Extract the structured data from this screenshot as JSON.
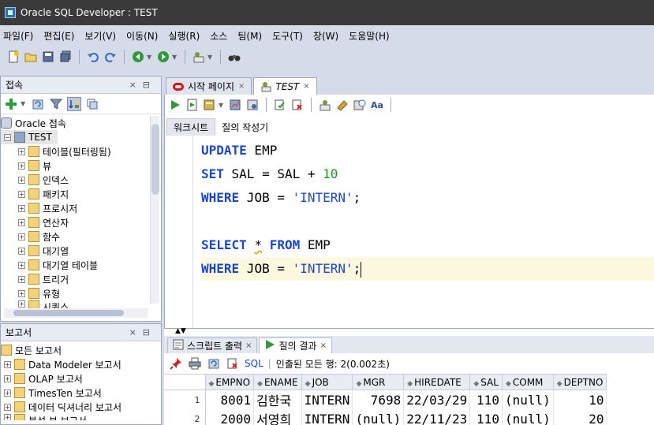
{
  "window": {
    "title": "Oracle SQL Developer : TEST"
  },
  "menu": [
    "파일(F)",
    "편집(E)",
    "보기(V)",
    "이동(N)",
    "실행(R)",
    "소스",
    "팀(M)",
    "도구(T)",
    "창(W)",
    "도움말(H)"
  ],
  "connections_panel": {
    "title": "접속",
    "tree": [
      {
        "label": "Oracle 접속",
        "level": 0,
        "icon": "database-icon",
        "expand": ""
      },
      {
        "label": "TEST",
        "level": 1,
        "icon": "connection-icon",
        "expand": "−"
      },
      {
        "label": "테이블(필터링됨)",
        "level": 2,
        "icon": "table-icon",
        "expand": "+"
      },
      {
        "label": "뷰",
        "level": 2,
        "icon": "view-icon",
        "expand": "+"
      },
      {
        "label": "인덱스",
        "level": 2,
        "icon": "index-icon",
        "expand": "+"
      },
      {
        "label": "패키지",
        "level": 2,
        "icon": "package-icon",
        "expand": "+"
      },
      {
        "label": "프로시저",
        "level": 2,
        "icon": "procedure-icon",
        "expand": "+"
      },
      {
        "label": "연산자",
        "level": 2,
        "icon": "operator-icon",
        "expand": "+"
      },
      {
        "label": "함수",
        "level": 2,
        "icon": "function-icon",
        "expand": "+"
      },
      {
        "label": "대기열",
        "level": 2,
        "icon": "queue-icon",
        "expand": "+"
      },
      {
        "label": "대기열 테이블",
        "level": 2,
        "icon": "queue-table-icon",
        "expand": "+"
      },
      {
        "label": "트리거",
        "level": 2,
        "icon": "trigger-icon",
        "expand": "+"
      },
      {
        "label": "유형",
        "level": 2,
        "icon": "type-icon",
        "expand": "+"
      },
      {
        "label": "시퀀스",
        "level": 2,
        "icon": "sequence-icon",
        "expand": "+"
      }
    ]
  },
  "reports_panel": {
    "title": "보고서",
    "tree": [
      {
        "label": "모든 보고서",
        "level": 0,
        "expand": ""
      },
      {
        "label": "Data Modeler 보고서",
        "level": 1,
        "expand": "+"
      },
      {
        "label": "OLAP 보고서",
        "level": 1,
        "expand": "+"
      },
      {
        "label": "TimesTen 보고서",
        "level": 1,
        "expand": "+"
      },
      {
        "label": "데이터 딕셔너리 보고서",
        "level": 1,
        "expand": "+"
      },
      {
        "label": "분석 뷰 보고서",
        "level": 1,
        "expand": "+"
      }
    ]
  },
  "editor_tabs": [
    {
      "label": "시작 페이지",
      "active": false
    },
    {
      "label": "TEST",
      "active": true
    }
  ],
  "worksheet_tabs": [
    "워크시트",
    "질의 작성기"
  ],
  "code_lines": [
    [
      [
        "kw",
        "UPDATE"
      ],
      [
        "",
        "  EMP"
      ]
    ],
    [
      [
        "kw",
        "SET"
      ],
      [
        "",
        "  SAL = SAL + "
      ],
      [
        "num",
        "10"
      ]
    ],
    [
      [
        "kw",
        "WHERE"
      ],
      [
        "",
        "  JOB = "
      ],
      [
        "str",
        "'INTERN'"
      ],
      [
        "",
        ";"
      ]
    ],
    [],
    [
      [
        "kw",
        "SELECT"
      ],
      [
        "",
        "  "
      ],
      [
        "squig",
        "*"
      ],
      [
        "",
        "  "
      ],
      [
        "kw",
        "FROM"
      ],
      [
        "",
        "  EMP"
      ]
    ],
    [
      [
        "kw",
        "WHERE"
      ],
      [
        "",
        "  JOB = "
      ],
      [
        "str",
        "'INTERN'"
      ],
      [
        "",
        ";"
      ],
      [
        "caret",
        ""
      ]
    ]
  ],
  "result_tabs": [
    {
      "label": "스크립트 출력",
      "active": false
    },
    {
      "label": "질의 결과",
      "active": true
    }
  ],
  "result_toolbar": {
    "sql_label": "SQL",
    "status": "인출된 모든 행: 2(0.002초)"
  },
  "grid": {
    "columns": [
      "EMPNO",
      "ENAME",
      "JOB",
      "MGR",
      "HIREDATE",
      "SAL",
      "COMM",
      "DEPTNO"
    ],
    "rows": [
      {
        "rownum": "1",
        "cells": [
          "8001",
          "김한국",
          "INTERN",
          "7698",
          "22/03/29",
          "110",
          "(null)",
          "10"
        ]
      },
      {
        "rownum": "2",
        "cells": [
          "2000",
          "서영희",
          "INTERN",
          "(null)",
          "22/11/23",
          "110",
          "(null)",
          "20"
        ]
      }
    ]
  },
  "colors": {
    "keyword": "#1a47c9",
    "number": "#238f23",
    "current_line": "#fdf9e0",
    "chrome": "#d6dbe9"
  }
}
